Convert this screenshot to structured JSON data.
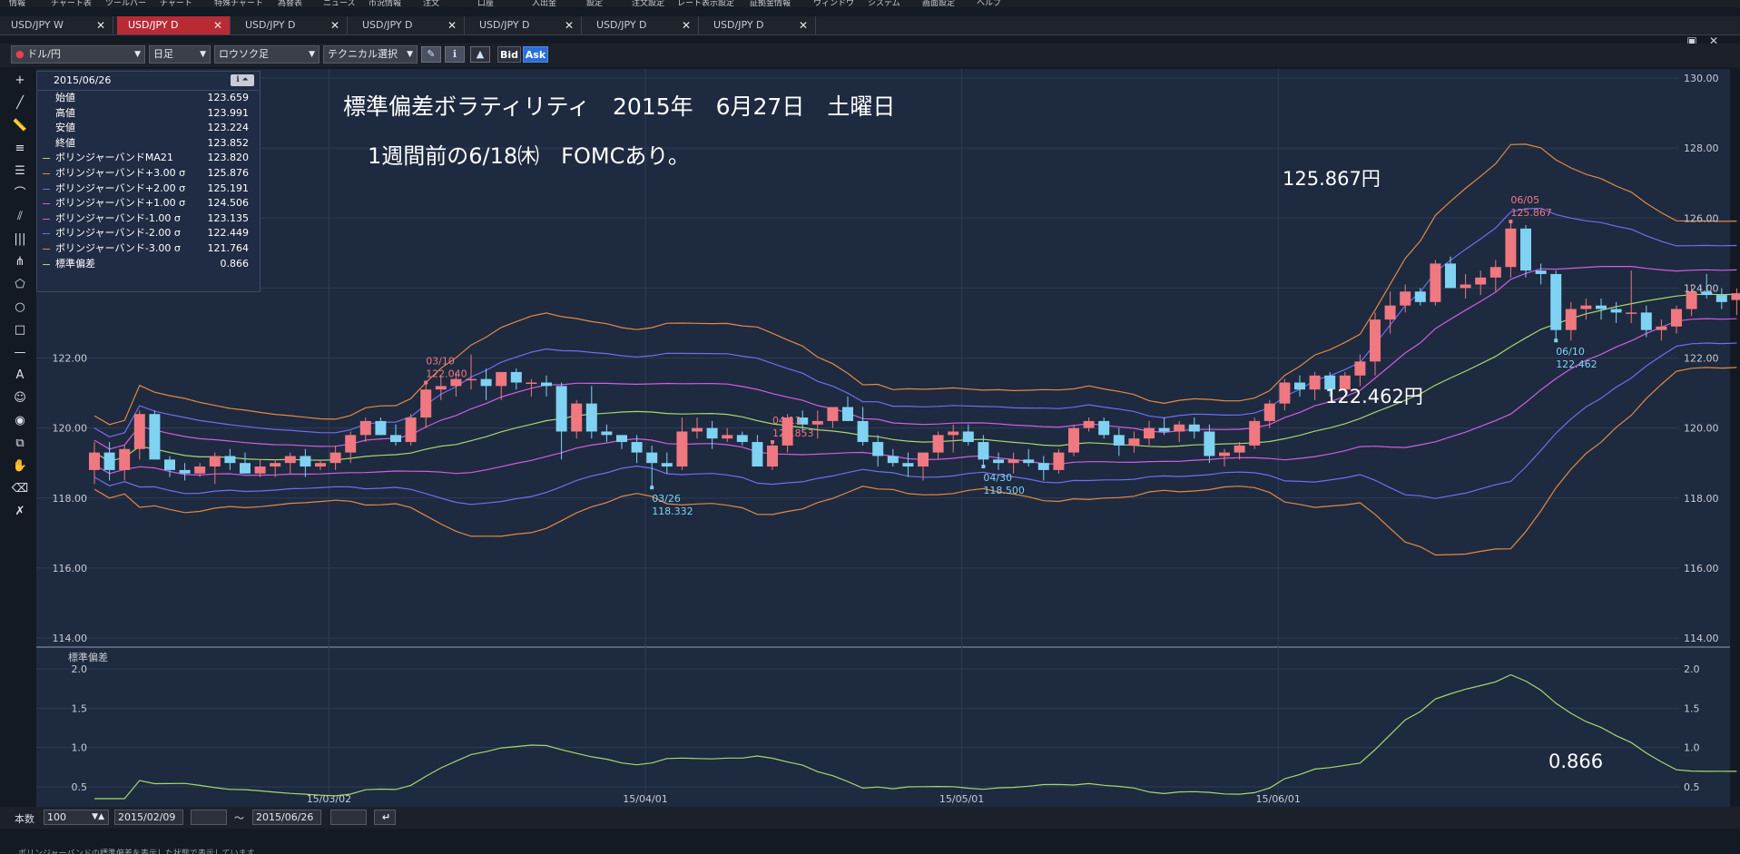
{
  "menu": {
    "items": [
      "情報",
      "チャート表",
      "ツールバー",
      "チャート",
      "特殊チャート",
      "為替表",
      "ニュース",
      "市況情報",
      "注文",
      "口座",
      "入出金",
      "設定",
      "注文設定",
      "レート表示設定",
      "証拠金情報",
      "ウィンドウ",
      "システム",
      "画面設定",
      "ヘルプ"
    ]
  },
  "tabs": [
    {
      "label": "USD/JPY W",
      "active": false
    },
    {
      "label": "USD/JPY D",
      "active": true
    },
    {
      "label": "USD/JPY D",
      "active": false
    },
    {
      "label": "USD/JPY D",
      "active": false
    },
    {
      "label": "USD/JPY D",
      "active": false
    },
    {
      "label": "USD/JPY D",
      "active": false
    },
    {
      "label": "USD/JPY D",
      "active": false
    }
  ],
  "toolbar": {
    "pair": "ドル/円",
    "period": "日足",
    "chart_type": "ロウソク足",
    "technical": "テクニカル選択",
    "bid_label": "Bid",
    "ask_label": "Ask"
  },
  "left_tools": [
    "crosshair-icon",
    "trendline-icon",
    "ruler-icon",
    "horizontal-lines-icon",
    "channel-icon",
    "arc-icon",
    "fan-icon",
    "vertical-lines-icon",
    "pitchfork-icon",
    "polygon-icon",
    "circle-icon",
    "rectangle-icon",
    "hline-icon",
    "text-icon",
    "stamp-icon",
    "magnet-icon",
    "copy-icon",
    "hand-icon",
    "eraser-icon",
    "eraser-all-icon"
  ],
  "info_panel": {
    "date": "2015/06/26",
    "rows": [
      {
        "label": "始値",
        "value": "123.659",
        "color": ""
      },
      {
        "label": "高値",
        "value": "123.991",
        "color": ""
      },
      {
        "label": "安値",
        "value": "123.224",
        "color": ""
      },
      {
        "label": "終値",
        "value": "123.852",
        "color": ""
      },
      {
        "label": "ボリンジャーバンドMA21",
        "value": "123.820",
        "color": "#a6d86a"
      },
      {
        "label": "ボリンジャーバンド+3.00 σ",
        "value": "125.876",
        "color": "#e28a3e"
      },
      {
        "label": "ボリンジャーバンド+2.00 σ",
        "value": "125.191",
        "color": "#6f6ef0"
      },
      {
        "label": "ボリンジャーバンド+1.00 σ",
        "value": "124.506",
        "color": "#d05ee0"
      },
      {
        "label": "ボリンジャーバンド-1.00 σ",
        "value": "123.135",
        "color": "#d05ee0"
      },
      {
        "label": "ボリンジャーバンド-2.00 σ",
        "value": "122.449",
        "color": "#6f6ef0"
      },
      {
        "label": "ボリンジャーバンド-3.00 σ",
        "value": "121.764",
        "color": "#e28a3e"
      },
      {
        "label": "標準偏差",
        "value": "0.866",
        "color": "#a6d86a"
      }
    ]
  },
  "annotations": {
    "title": "標準偏差ボラティリティ　2015年　6月27日　土曜日",
    "subtitle": "1週間前の6/18㈭　FOMCあり。",
    "high_label": "125.867円",
    "low_label": "122.462円",
    "stddev_label": "0.866"
  },
  "chart_data": [
    {
      "type": "candlestick",
      "x_ticks": [
        "15/03/02",
        "15/04/01",
        "15/05/01",
        "15/06/01"
      ],
      "ylim": [
        114,
        130
      ],
      "y_ticks": [
        "114.00",
        "116.00",
        "118.00",
        "120.00",
        "122.00",
        "124.00",
        "126.00",
        "128.00",
        "130.00"
      ],
      "candles": [
        [
          118.8,
          119.6,
          118.4,
          119.3
        ],
        [
          119.3,
          119.6,
          118.5,
          118.8
        ],
        [
          118.8,
          119.5,
          118.5,
          119.4
        ],
        [
          119.4,
          120.5,
          119.1,
          120.4
        ],
        [
          120.4,
          120.5,
          119.1,
          119.1
        ],
        [
          119.1,
          119.2,
          118.6,
          118.8
        ],
        [
          118.8,
          119.0,
          118.5,
          118.7
        ],
        [
          118.7,
          119.0,
          118.6,
          118.9
        ],
        [
          118.9,
          119.3,
          118.4,
          119.2
        ],
        [
          119.2,
          119.4,
          118.8,
          119.0
        ],
        [
          119.0,
          119.3,
          118.7,
          118.7
        ],
        [
          118.7,
          119.1,
          118.6,
          118.9
        ],
        [
          118.9,
          119.1,
          118.6,
          119.0
        ],
        [
          119.0,
          119.3,
          118.7,
          119.2
        ],
        [
          119.2,
          119.4,
          118.6,
          118.9
        ],
        [
          118.9,
          119.1,
          118.8,
          119.0
        ],
        [
          119.0,
          119.5,
          118.8,
          119.3
        ],
        [
          119.3,
          119.9,
          119.0,
          119.8
        ],
        [
          119.8,
          120.3,
          119.6,
          120.2
        ],
        [
          120.2,
          120.3,
          119.8,
          119.8
        ],
        [
          119.8,
          120.1,
          119.5,
          119.6
        ],
        [
          119.6,
          120.4,
          119.5,
          120.3
        ],
        [
          120.3,
          121.3,
          120.0,
          121.1
        ],
        [
          121.1,
          121.5,
          120.8,
          121.2
        ],
        [
          121.2,
          121.6,
          120.9,
          121.4
        ],
        [
          121.4,
          122.1,
          121.1,
          121.4
        ],
        [
          121.4,
          121.7,
          120.8,
          121.2
        ],
        [
          121.2,
          121.6,
          120.8,
          121.6
        ],
        [
          121.6,
          121.7,
          121.1,
          121.3
        ],
        [
          121.3,
          121.4,
          120.9,
          121.3
        ],
        [
          121.3,
          121.5,
          120.9,
          121.2
        ],
        [
          121.2,
          121.3,
          119.1,
          119.9
        ],
        [
          119.9,
          120.8,
          119.7,
          120.7
        ],
        [
          120.7,
          121.2,
          119.7,
          119.9
        ],
        [
          119.9,
          120.1,
          119.6,
          119.8
        ],
        [
          119.8,
          119.8,
          119.4,
          119.6
        ],
        [
          119.6,
          119.8,
          119.0,
          119.3
        ],
        [
          119.3,
          119.5,
          118.3,
          119.0
        ],
        [
          119.0,
          119.3,
          118.7,
          118.9
        ],
        [
          118.9,
          120.3,
          118.8,
          119.9
        ],
        [
          119.9,
          120.3,
          119.7,
          120.0
        ],
        [
          120.0,
          120.2,
          119.4,
          119.7
        ],
        [
          119.7,
          120.0,
          119.6,
          119.8
        ],
        [
          119.8,
          119.9,
          119.5,
          119.6
        ],
        [
          119.6,
          119.8,
          118.9,
          118.9
        ],
        [
          118.9,
          119.6,
          118.8,
          119.5
        ],
        [
          119.5,
          120.4,
          119.3,
          120.3
        ],
        [
          120.3,
          120.5,
          119.9,
          120.1
        ],
        [
          120.1,
          120.5,
          119.7,
          120.2
        ],
        [
          120.2,
          120.6,
          120.0,
          120.6
        ],
        [
          120.6,
          120.9,
          120.2,
          120.2
        ],
        [
          120.2,
          120.6,
          119.5,
          119.6
        ],
        [
          119.6,
          119.8,
          118.9,
          119.2
        ],
        [
          119.2,
          119.4,
          118.9,
          119.0
        ],
        [
          119.0,
          119.3,
          118.6,
          118.9
        ],
        [
          118.9,
          119.3,
          118.5,
          119.3
        ],
        [
          119.3,
          119.9,
          119.1,
          119.8
        ],
        [
          119.8,
          120.1,
          119.3,
          119.9
        ],
        [
          119.9,
          120.1,
          119.5,
          119.6
        ],
        [
          119.6,
          119.8,
          118.9,
          119.1
        ],
        [
          119.1,
          119.3,
          118.8,
          119.0
        ],
        [
          119.0,
          119.3,
          118.7,
          119.1
        ],
        [
          119.1,
          119.4,
          118.9,
          119.0
        ],
        [
          119.0,
          119.2,
          118.5,
          118.8
        ],
        [
          118.8,
          119.4,
          118.7,
          119.3
        ],
        [
          119.3,
          120.1,
          119.2,
          120.0
        ],
        [
          120.0,
          120.3,
          119.9,
          120.2
        ],
        [
          120.2,
          120.3,
          119.7,
          119.8
        ],
        [
          119.8,
          120.0,
          119.2,
          119.5
        ],
        [
          119.5,
          119.9,
          119.3,
          119.7
        ],
        [
          119.7,
          120.2,
          119.5,
          120.0
        ],
        [
          120.0,
          120.3,
          119.8,
          119.9
        ],
        [
          119.9,
          120.2,
          119.6,
          120.1
        ],
        [
          120.1,
          120.3,
          119.7,
          119.9
        ],
        [
          119.9,
          120.1,
          119.0,
          119.2
        ],
        [
          119.2,
          119.4,
          118.9,
          119.3
        ],
        [
          119.3,
          119.6,
          119.1,
          119.5
        ],
        [
          119.5,
          120.3,
          119.4,
          120.2
        ],
        [
          120.2,
          120.8,
          120.0,
          120.7
        ],
        [
          120.7,
          121.4,
          120.5,
          121.3
        ],
        [
          121.3,
          121.5,
          120.9,
          121.1
        ],
        [
          121.1,
          121.6,
          120.8,
          121.5
        ],
        [
          121.5,
          121.6,
          120.9,
          121.1
        ],
        [
          121.1,
          121.6,
          121.0,
          121.5
        ],
        [
          121.5,
          122.1,
          121.2,
          121.9
        ],
        [
          121.9,
          123.3,
          121.5,
          123.1
        ],
        [
          123.1,
          123.9,
          122.7,
          123.5
        ],
        [
          123.5,
          124.1,
          123.3,
          123.9
        ],
        [
          123.9,
          124.0,
          123.5,
          123.6
        ],
        [
          123.6,
          124.8,
          123.5,
          124.7
        ],
        [
          124.7,
          124.9,
          124.0,
          124.0
        ],
        [
          124.0,
          124.4,
          123.7,
          124.1
        ],
        [
          124.1,
          124.5,
          123.8,
          124.3
        ],
        [
          124.3,
          124.8,
          123.9,
          124.6
        ],
        [
          124.6,
          125.9,
          124.3,
          125.7
        ],
        [
          125.7,
          125.8,
          124.3,
          124.5
        ],
        [
          124.5,
          124.7,
          124.1,
          124.4
        ],
        [
          124.4,
          124.5,
          122.5,
          122.8
        ],
        [
          122.8,
          123.6,
          122.5,
          123.4
        ],
        [
          123.4,
          123.7,
          123.1,
          123.5
        ],
        [
          123.5,
          123.7,
          123.1,
          123.4
        ],
        [
          123.4,
          123.6,
          123.0,
          123.3
        ],
        [
          123.3,
          124.5,
          123.0,
          123.3
        ],
        [
          123.3,
          123.5,
          122.6,
          122.8
        ],
        [
          122.8,
          123.1,
          122.5,
          122.9
        ],
        [
          122.9,
          123.5,
          122.7,
          123.4
        ],
        [
          123.4,
          124.1,
          123.2,
          123.9
        ],
        [
          123.9,
          124.4,
          123.7,
          123.8
        ],
        [
          123.8,
          124.0,
          123.4,
          123.6
        ],
        [
          123.659,
          123.991,
          123.224,
          123.852
        ]
      ],
      "point_labels": [
        {
          "date": "03/10",
          "value": "122.040",
          "kind": "high"
        },
        {
          "date": "03/26",
          "value": "118.332",
          "kind": "low"
        },
        {
          "date": "04/13",
          "value": "120.853",
          "kind": "high"
        },
        {
          "date": "04/30",
          "value": "118.500",
          "kind": "low"
        },
        {
          "date": "06/05",
          "value": "125.867",
          "kind": "high"
        },
        {
          "date": "06/10",
          "value": "122.462",
          "kind": "low"
        }
      ],
      "colors": {
        "up": "#f07880",
        "down": "#7fd2f2",
        "ma": "#a6d86a",
        "s1": "#d05ee0",
        "s2": "#6f6ef0",
        "s3": "#e28a3e"
      }
    },
    {
      "type": "line",
      "title": "標準偏差",
      "ylim": [
        0.35,
        2.15
      ],
      "y_ticks": [
        "0.5",
        "1.0",
        "1.5",
        "2.0"
      ],
      "series": [
        {
          "name": "標準偏差",
          "color": "#a6d86a"
        }
      ]
    }
  ],
  "statusbar": {
    "count_label": "本数",
    "count_value": "100",
    "date_from": "2015/02/09",
    "tilde": "～",
    "date_to": "2015/06/26"
  },
  "footer_text": "ボリンジャーバンドの標準偏差を表示した状態で表示しています"
}
